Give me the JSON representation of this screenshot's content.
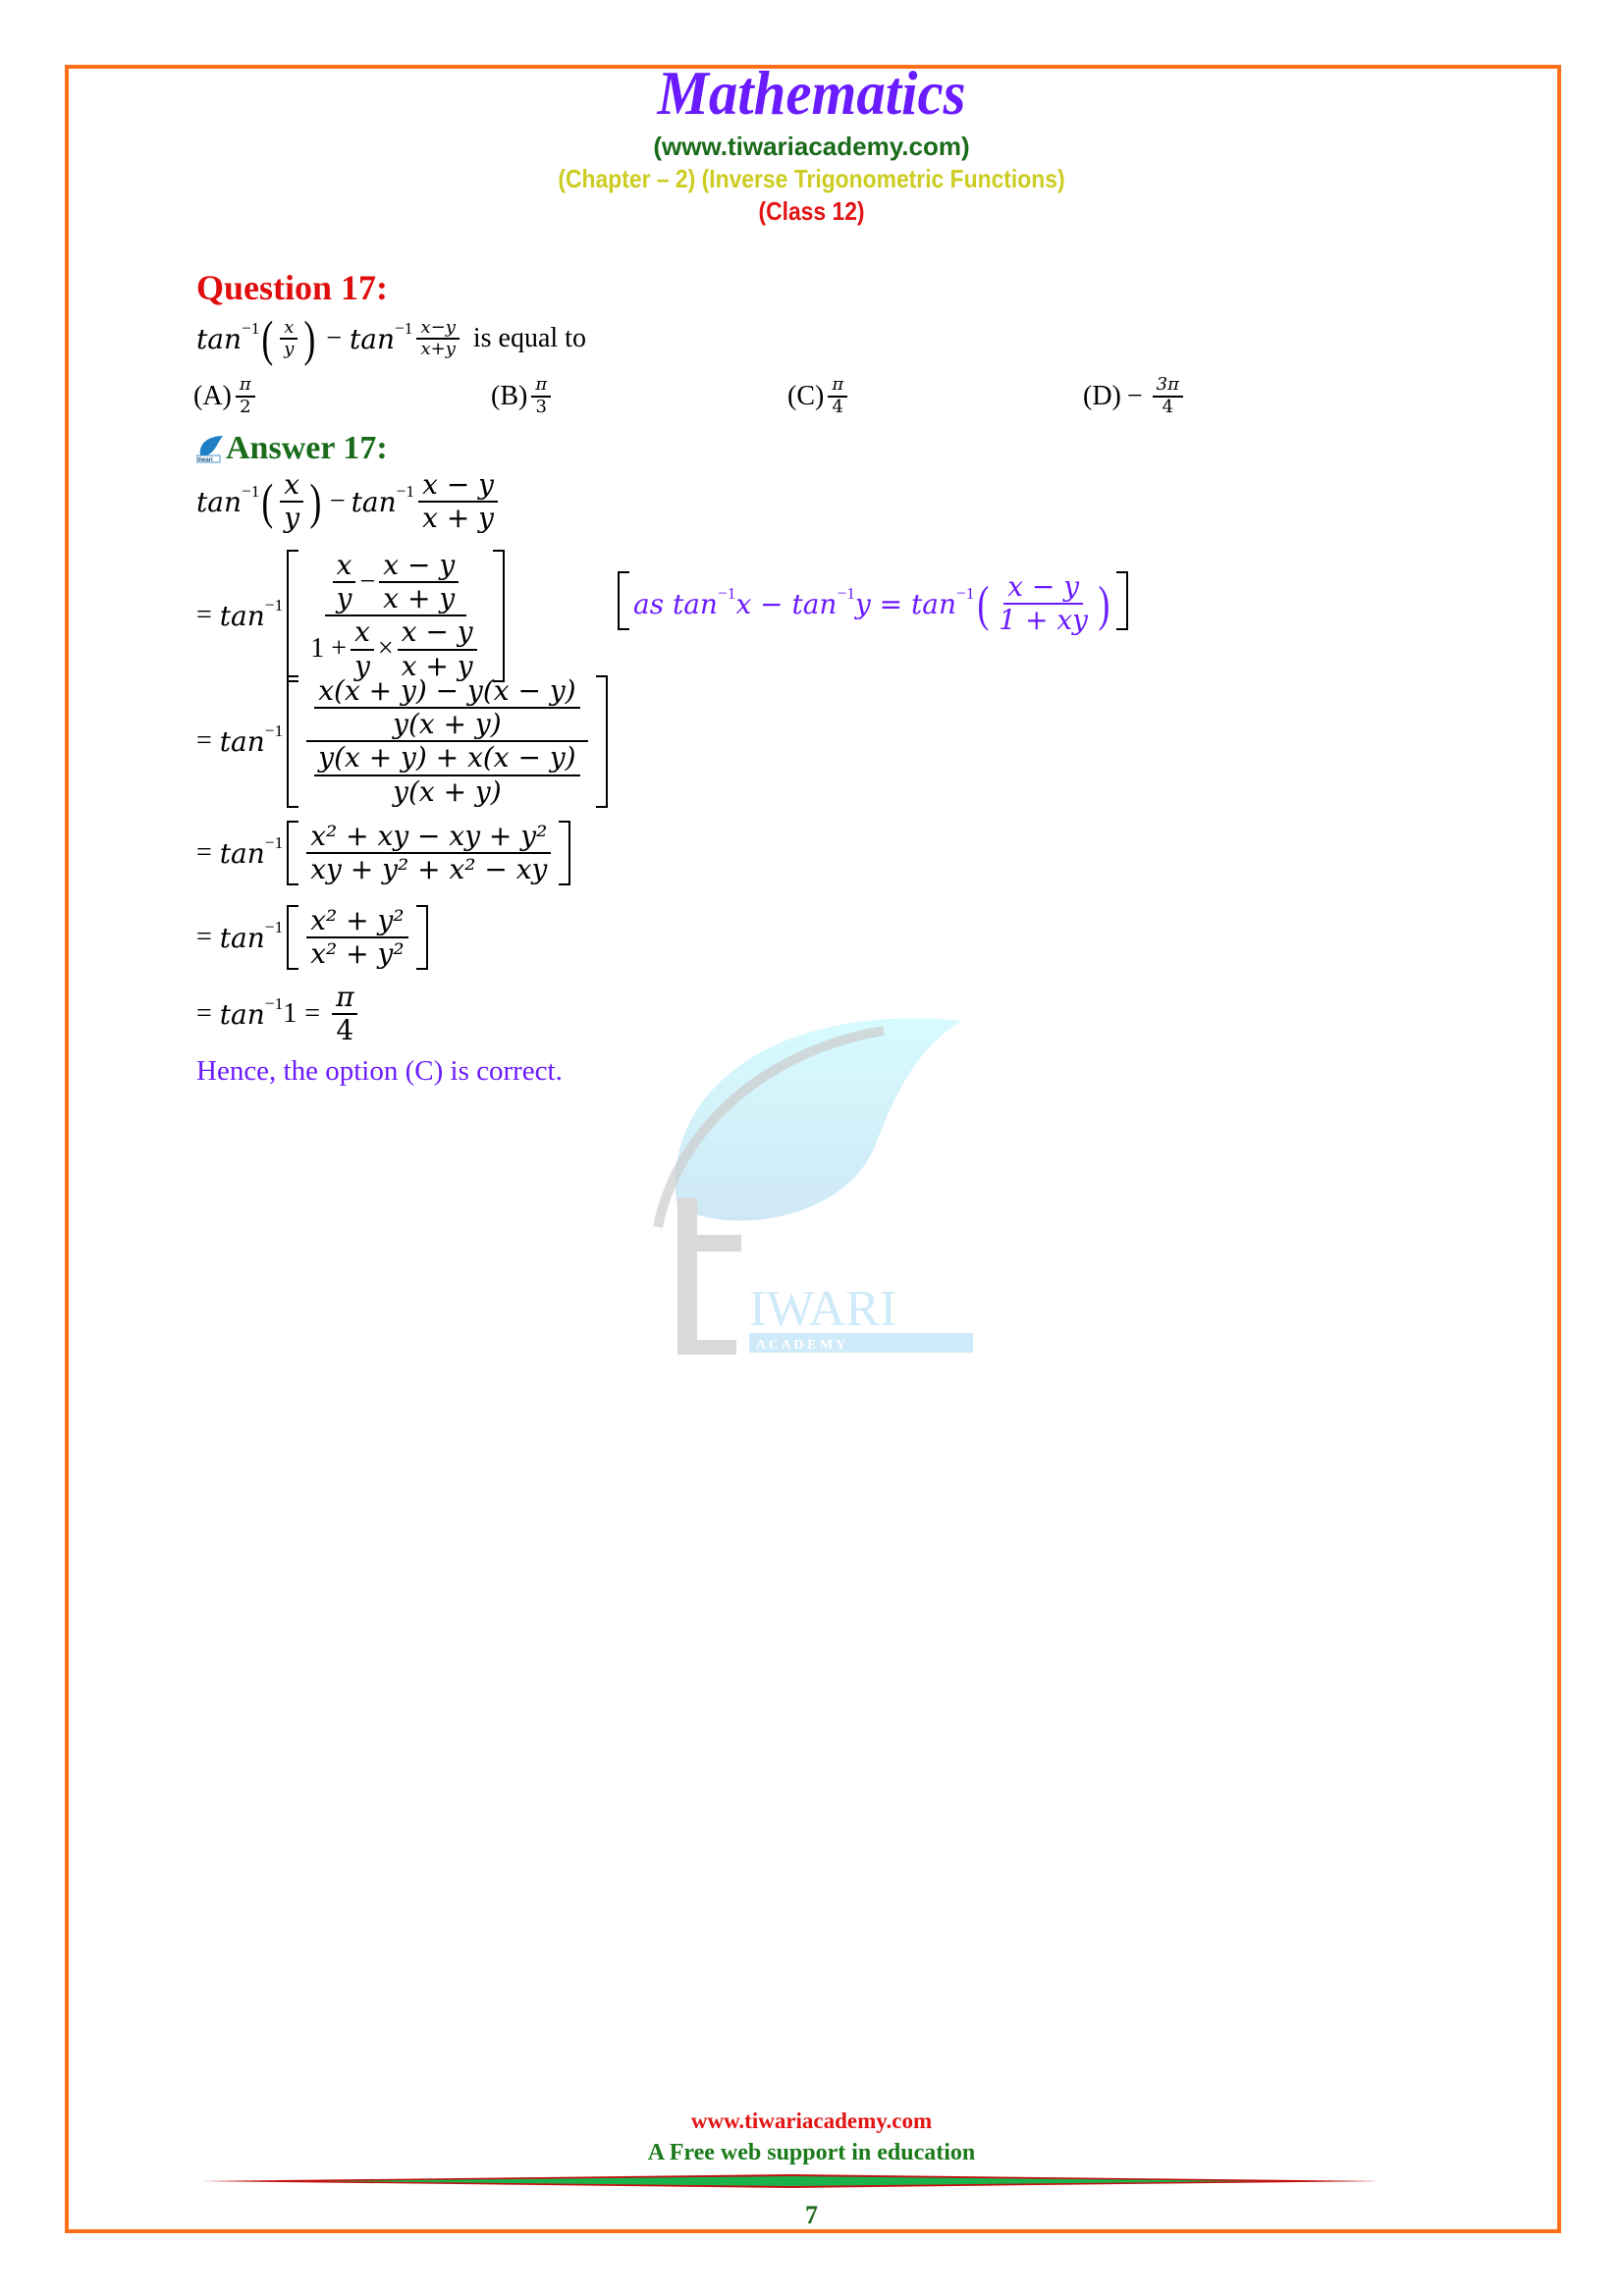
{
  "header": {
    "title": "Mathematics",
    "site": "(www.tiwariacademy.com)",
    "chapter": "(Chapter – 2) (Inverse Trigonometric Functions)",
    "class": "(Class 12)"
  },
  "question": {
    "heading": "Question 17",
    "heading_colon": ":",
    "expression": {
      "fn": "tan",
      "inv": "−1",
      "term1_num": "x",
      "term1_den": "y",
      "minus": "−",
      "term2_num": "x−y",
      "term2_den": "x+y"
    },
    "prompt": "is equal to",
    "options": [
      {
        "label": "(A)",
        "sign": "",
        "num": "π",
        "den": "2"
      },
      {
        "label": "(B)",
        "sign": "",
        "num": "π",
        "den": "3"
      },
      {
        "label": "(C)",
        "sign": "",
        "num": "π",
        "den": "4"
      },
      {
        "label": "(D)",
        "sign": "−",
        "num": "3π",
        "den": "4"
      }
    ]
  },
  "answer": {
    "heading": "Answer 17:",
    "icon": "tiwari-leaf-logo-icon",
    "steps": {
      "s1": {
        "fn": "tan",
        "inv": "−1",
        "a_num": "x",
        "a_den": "y",
        "op": "−",
        "b_num": "x − y",
        "b_den": "x + y"
      },
      "s2": {
        "eq": "=",
        "fn": "tan",
        "inv": "−1",
        "n1_num": "x",
        "n1_den": "y",
        "n_op": "−",
        "n2_num": "x − y",
        "n2_den": "x + y",
        "d_one": "1 +",
        "d1_num": "x",
        "d1_den": "y",
        "d_op": "×",
        "d2_num": "x − y",
        "d2_den": "x + y"
      },
      "s3": {
        "eq": "=",
        "fn": "tan",
        "inv": "−1",
        "top_num": "x(x + y) − y(x − y)",
        "top_den": "y(x + y)",
        "bot_num": "y(x + y) + x(x − y)",
        "bot_den": "y(x + y)"
      },
      "s4": {
        "eq": "=",
        "fn": "tan",
        "inv": "−1",
        "num": "x² + xy − xy + y²",
        "den": "xy + y² + x² − xy"
      },
      "s5": {
        "eq": "=",
        "fn": "tan",
        "inv": "−1",
        "num": "x² + y²",
        "den": "x² + y²"
      },
      "s6": {
        "eq": "=",
        "fn": "tan",
        "inv": "−1",
        "arg": "1",
        "eq2": "=",
        "num": "π",
        "den": "4"
      }
    },
    "note": {
      "prefix": "as tan",
      "inv": "−1",
      "x": "x − tan",
      "inv2": "−1",
      "y": "y = tan",
      "inv3": "−1",
      "num": "x − y",
      "den": "1 + xy"
    },
    "conclusion": "Hence, the option (C) is correct."
  },
  "watermark": {
    "text": "IWARI",
    "subtext": "A C A D E M Y"
  },
  "footer": {
    "site": "www.tiwariacademy.com",
    "tagline": "A Free web support in education",
    "page_number": "7"
  },
  "colors": {
    "border": "#ff6f1a",
    "title": "#6a1bff",
    "site": "#1a6b1a",
    "chapter": "#cccc22",
    "class": "#e21414",
    "question_heading": "#e00d0d",
    "answer_heading": "#1a6b1a",
    "note": "#6a1bff"
  }
}
